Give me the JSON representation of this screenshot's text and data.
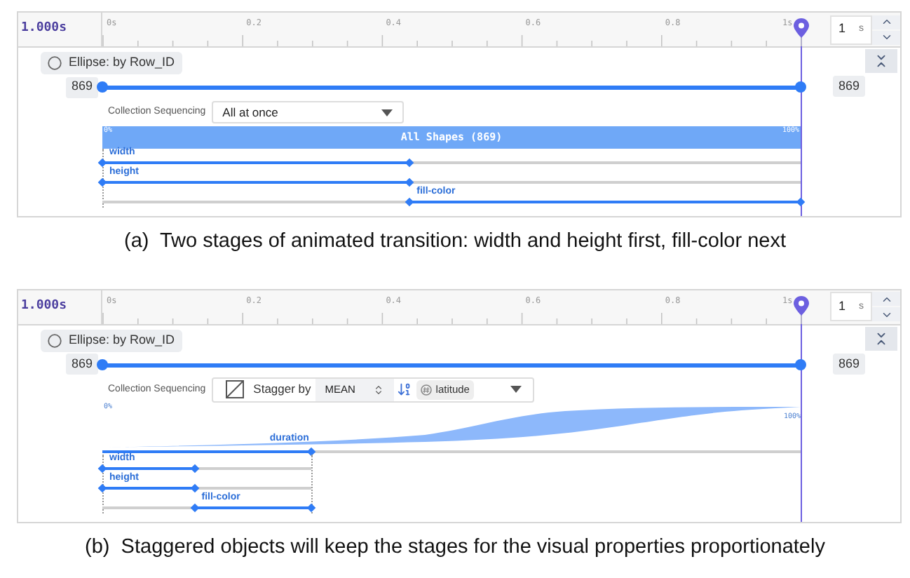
{
  "figure_panels": [
    {
      "time_readout": "1.000s",
      "ticks": [
        "0s",
        "0.2",
        "0.4",
        "0.6",
        "0.8",
        "1s"
      ],
      "duration_field": {
        "value": "1",
        "unit": "s"
      },
      "layer": {
        "name": "Ellipse: by Row_ID"
      },
      "count_start": "869",
      "count_end": "869",
      "sequencing": {
        "label": "Collection Sequencing",
        "kind": "dropdown",
        "value": "All at once"
      },
      "group": {
        "kind": "bar",
        "start_label": "0%",
        "label": "All Shapes (869)",
        "end_label": "100%"
      },
      "duration_handle": {
        "level": 1
      },
      "stage_split": {
        "level": 0.44
      },
      "tracks": [
        {
          "name": "width",
          "kind": "first"
        },
        {
          "name": "height",
          "kind": "first"
        },
        {
          "name": "fill-color",
          "kind": "second"
        }
      ],
      "caption": "(a)  Two stages of animated transition: width and height first, fill-color next"
    },
    {
      "time_readout": "1.000s",
      "ticks": [
        "0s",
        "0.2",
        "0.4",
        "0.6",
        "0.8",
        "1s"
      ],
      "duration_field": {
        "value": "1",
        "unit": "s"
      },
      "layer": {
        "name": "Ellipse: by Row_ID"
      },
      "count_start": "869",
      "count_end": "869",
      "sequencing": {
        "label": "Collection Sequencing",
        "kind": "stagger",
        "stagger_label": "Stagger by",
        "aggregate": "MEAN",
        "field": "latitude"
      },
      "group": {
        "kind": "area",
        "start_label": "0%",
        "end_label": "100%",
        "duration_label": "duration"
      },
      "duration_handle": {
        "level": 0.3
      },
      "stage_split": {
        "level": 0.44
      },
      "tracks": [
        {
          "name": "width",
          "kind": "first"
        },
        {
          "name": "height",
          "kind": "first"
        },
        {
          "name": "fill-color",
          "kind": "second"
        }
      ],
      "caption": "(b)  Staggered objects will keep the stages for the visual properties proportionately"
    }
  ]
}
